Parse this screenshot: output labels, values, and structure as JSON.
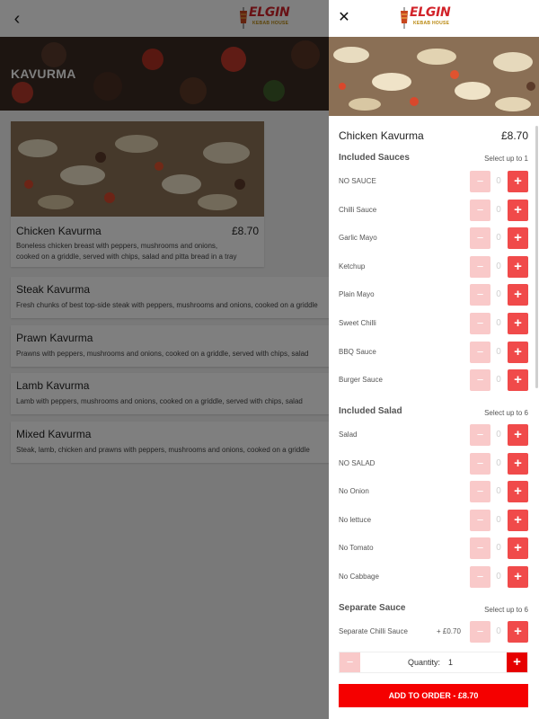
{
  "header": {
    "back_icon": "chevron-left-icon",
    "logo_text": "ELGIN",
    "logo_sub": "KEBAB HOUSE"
  },
  "category": {
    "title": "KAVURMA"
  },
  "menu_items": [
    {
      "name": "Chicken Kavurma",
      "price": "£8.70",
      "desc_1": "Boneless chicken breast with peppers, mushrooms and onions,",
      "desc_2": "cooked on a griddle, served with chips, salad and pitta bread in a tray"
    },
    {
      "name": "Steak Kavurma",
      "desc": "Fresh chunks of best top-side steak with peppers, mushrooms and onions, cooked on a griddle"
    },
    {
      "name": "Prawn Kavurma",
      "desc": "Prawns with peppers, mushrooms and onions, cooked on a griddle, served with chips, salad"
    },
    {
      "name": "Lamb Kavurma",
      "desc": "Lamb with peppers, mushrooms and onions, cooked on a griddle, served with chips, salad"
    },
    {
      "name": "Mixed Kavurma",
      "desc": "Steak, lamb, chicken and prawns with peppers, mushrooms and onions, cooked on a griddle"
    }
  ],
  "panel": {
    "close_icon": "close-icon",
    "item_name": "Chicken Kavurma",
    "item_price": "£8.70",
    "sections": [
      {
        "title": "Included Sauces",
        "hint": "Select up to 1",
        "options": [
          "NO SAUCE",
          "Chilli Sauce",
          "Garlic Mayo",
          "Ketchup",
          "Plain Mayo",
          "Sweet Chilli",
          "BBQ Sauce",
          "Burger Sauce"
        ]
      },
      {
        "title": "Included Salad",
        "hint": "Select up to 6",
        "options": [
          "Salad",
          "NO SALAD",
          "No Onion",
          "No lettuce",
          "No Tomato",
          "No Cabbage"
        ]
      },
      {
        "title": "Separate Sauce",
        "hint": "Select up to 6",
        "options": [
          "Separate Chilli Sauce"
        ],
        "extra": "+ £0.70"
      }
    ],
    "option_value": "0",
    "minus": "−",
    "plus": "+",
    "quantity_label": "Quantity:",
    "quantity_value": "1",
    "add_button": "ADD TO ORDER  -  £8.70"
  },
  "colors": {
    "accent": "#f50000",
    "plus": "#f04a4a",
    "minus": "#f9c9c9"
  }
}
